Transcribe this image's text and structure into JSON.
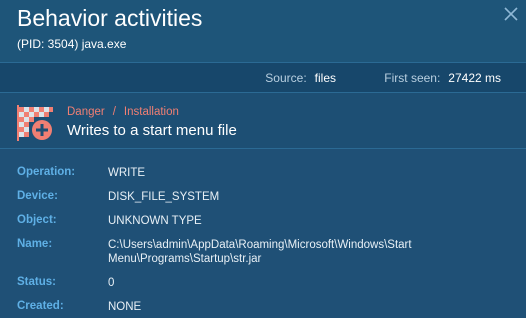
{
  "header": {
    "title": "Behavior activities",
    "subtitle": "(PID: 3504) java.exe",
    "close_icon": "close-icon"
  },
  "meta": {
    "source_label": "Source:",
    "source_value": "files",
    "first_seen_label": "First seen:",
    "first_seen_value": "27422 ms"
  },
  "event": {
    "icon": "danger-flag-add-icon",
    "severity": "Danger",
    "separator": "/",
    "category": "Installation",
    "title": "Writes to a start menu file"
  },
  "details": [
    {
      "key": "Operation:",
      "value": "WRITE"
    },
    {
      "key": "Device:",
      "value": "DISK_FILE_SYSTEM"
    },
    {
      "key": "Object:",
      "value": "UNKNOWN TYPE"
    },
    {
      "key": "Name:",
      "value": "C:\\Users\\admin\\AppData\\Roaming\\Microsoft\\Windows\\Start Menu\\Programs\\Startup\\str.jar"
    },
    {
      "key": "Status:",
      "value": "0"
    },
    {
      "key": "Created:",
      "value": "NONE"
    }
  ],
  "colors": {
    "background": "#1f5076",
    "danger": "#f07f73",
    "key_label": "#5fb0e6"
  }
}
